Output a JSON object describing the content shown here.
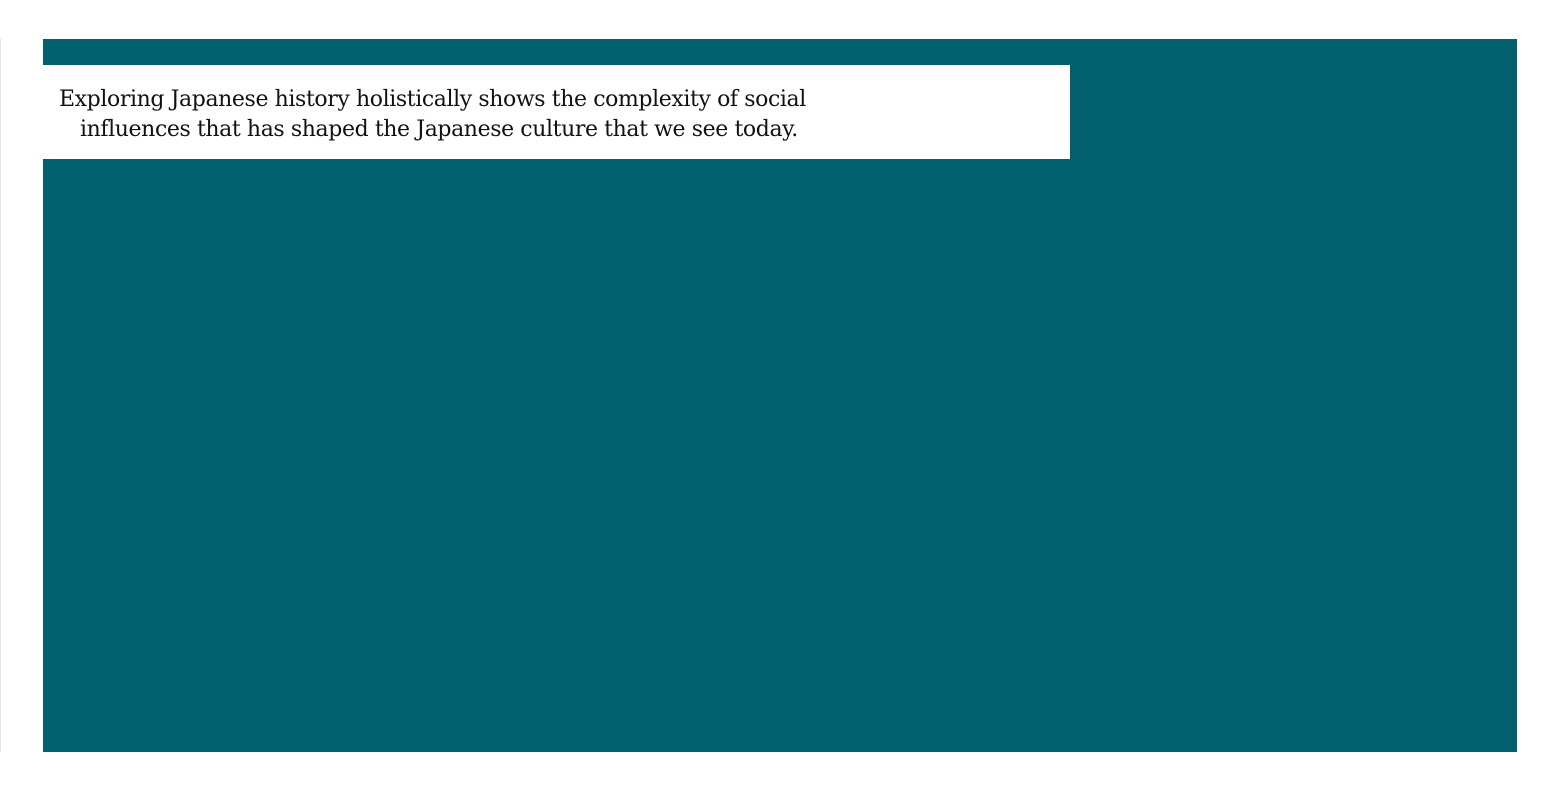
{
  "slide": {
    "background_color": "#03606e",
    "caption": {
      "line1": "Exploring Japanese history holistically shows the complexity of social",
      "line2": "influences that has shaped the Japanese culture that we see today."
    }
  }
}
